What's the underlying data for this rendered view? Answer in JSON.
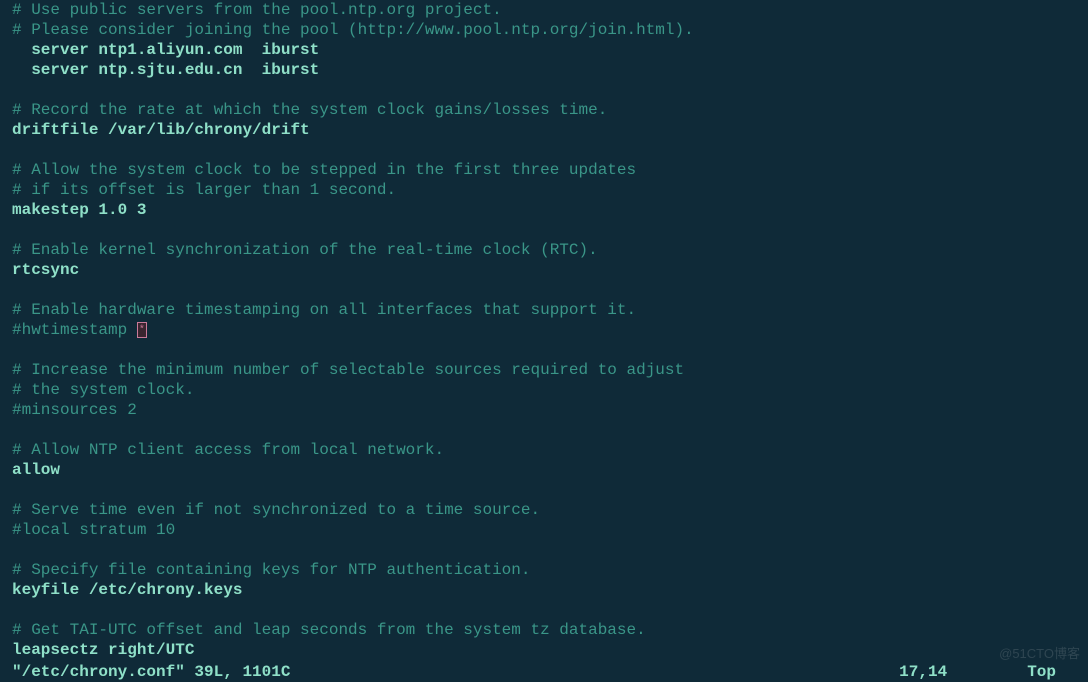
{
  "editor": {
    "lines": [
      {
        "type": "comment",
        "text": "# Use public servers from the pool.ntp.org project."
      },
      {
        "type": "comment",
        "text": "# Please consider joining the pool (http://www.pool.ntp.org/join.html)."
      },
      {
        "type": "directive",
        "text": "  server ntp1.aliyun.com  iburst"
      },
      {
        "type": "directive",
        "text": "  server ntp.sjtu.edu.cn  iburst"
      },
      {
        "type": "blank",
        "text": ""
      },
      {
        "type": "comment",
        "text": "# Record the rate at which the system clock gains/losses time."
      },
      {
        "type": "directive",
        "text": "driftfile /var/lib/chrony/drift"
      },
      {
        "type": "blank",
        "text": ""
      },
      {
        "type": "comment",
        "text": "# Allow the system clock to be stepped in the first three updates"
      },
      {
        "type": "comment",
        "text": "# if its offset is larger than 1 second."
      },
      {
        "type": "directive",
        "text": "makestep 1.0 3"
      },
      {
        "type": "blank",
        "text": ""
      },
      {
        "type": "comment",
        "text": "# Enable kernel synchronization of the real-time clock (RTC)."
      },
      {
        "type": "directive",
        "text": "rtcsync"
      },
      {
        "type": "blank",
        "text": ""
      },
      {
        "type": "comment",
        "text": "# Enable hardware timestamping on all interfaces that support it."
      },
      {
        "type": "cursor",
        "text": "#hwtimestamp "
      },
      {
        "type": "blank",
        "text": ""
      },
      {
        "type": "comment",
        "text": "# Increase the minimum number of selectable sources required to adjust"
      },
      {
        "type": "comment",
        "text": "# the system clock."
      },
      {
        "type": "comment",
        "text": "#minsources 2"
      },
      {
        "type": "blank",
        "text": ""
      },
      {
        "type": "comment",
        "text": "# Allow NTP client access from local network."
      },
      {
        "type": "directive",
        "text": "allow"
      },
      {
        "type": "blank",
        "text": ""
      },
      {
        "type": "comment",
        "text": "# Serve time even if not synchronized to a time source."
      },
      {
        "type": "comment",
        "text": "#local stratum 10"
      },
      {
        "type": "blank",
        "text": ""
      },
      {
        "type": "comment",
        "text": "# Specify file containing keys for NTP authentication."
      },
      {
        "type": "directive",
        "text": "keyfile /etc/chrony.keys"
      },
      {
        "type": "blank",
        "text": ""
      },
      {
        "type": "comment",
        "text": "# Get TAI-UTC offset and leap seconds from the system tz database."
      },
      {
        "type": "directive",
        "text": "leapsectz right/UTC"
      }
    ]
  },
  "status": {
    "file_info": "\"/etc/chrony.conf\" 39L, 1101C",
    "cursor_pos": "17,14",
    "scroll": "Top"
  },
  "watermark": "@51CTO博客"
}
